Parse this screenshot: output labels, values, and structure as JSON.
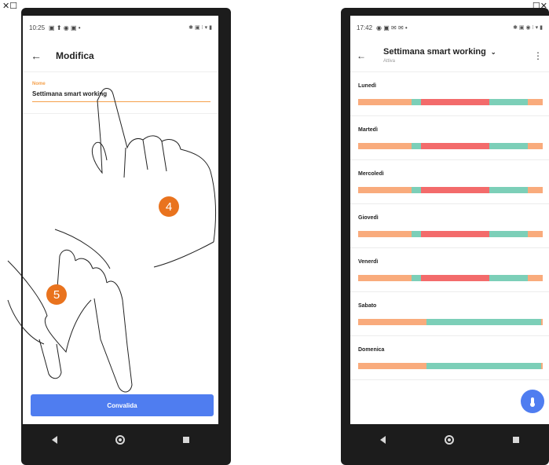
{
  "left_screen": {
    "status_time": "10:25",
    "title": "Modifica",
    "field_label": "Nome",
    "field_value": "Settimana smart working",
    "confirm_label": "Convalida"
  },
  "right_screen": {
    "status_time": "17:42",
    "title": "Settimana smart working",
    "subtitle": "Attiva",
    "days": [
      {
        "label": "Lunedì",
        "segments": [
          {
            "color": "#f9ab7c",
            "frac": 0.29
          },
          {
            "color": "#7ccfb8",
            "frac": 0.05
          },
          {
            "color": "#f36b6b",
            "frac": 0.37
          },
          {
            "color": "#7ccfb8",
            "frac": 0.21
          },
          {
            "color": "#f9ab7c",
            "frac": 0.08
          }
        ]
      },
      {
        "label": "Martedì",
        "segments": [
          {
            "color": "#f9ab7c",
            "frac": 0.29
          },
          {
            "color": "#7ccfb8",
            "frac": 0.05
          },
          {
            "color": "#f36b6b",
            "frac": 0.37
          },
          {
            "color": "#7ccfb8",
            "frac": 0.21
          },
          {
            "color": "#f9ab7c",
            "frac": 0.08
          }
        ]
      },
      {
        "label": "Mercoledì",
        "segments": [
          {
            "color": "#f9ab7c",
            "frac": 0.29
          },
          {
            "color": "#7ccfb8",
            "frac": 0.05
          },
          {
            "color": "#f36b6b",
            "frac": 0.37
          },
          {
            "color": "#7ccfb8",
            "frac": 0.21
          },
          {
            "color": "#f9ab7c",
            "frac": 0.08
          }
        ]
      },
      {
        "label": "Giovedì",
        "segments": [
          {
            "color": "#f9ab7c",
            "frac": 0.29
          },
          {
            "color": "#7ccfb8",
            "frac": 0.05
          },
          {
            "color": "#f36b6b",
            "frac": 0.37
          },
          {
            "color": "#7ccfb8",
            "frac": 0.21
          },
          {
            "color": "#f9ab7c",
            "frac": 0.08
          }
        ]
      },
      {
        "label": "Venerdì",
        "segments": [
          {
            "color": "#f9ab7c",
            "frac": 0.29
          },
          {
            "color": "#7ccfb8",
            "frac": 0.05
          },
          {
            "color": "#f36b6b",
            "frac": 0.37
          },
          {
            "color": "#7ccfb8",
            "frac": 0.21
          },
          {
            "color": "#f9ab7c",
            "frac": 0.08
          }
        ]
      },
      {
        "label": "Sabato",
        "segments": [
          {
            "color": "#f9ab7c",
            "frac": 0.37
          },
          {
            "color": "#7ccfb8",
            "frac": 0.62
          },
          {
            "color": "#f9ab7c",
            "frac": 0.01
          }
        ]
      },
      {
        "label": "Domenica",
        "segments": [
          {
            "color": "#f9ab7c",
            "frac": 0.37
          },
          {
            "color": "#7ccfb8",
            "frac": 0.62
          },
          {
            "color": "#f9ab7c",
            "frac": 0.01
          }
        ]
      }
    ]
  },
  "steps": {
    "first": "4",
    "second": "5"
  },
  "colors": {
    "accent": "#4f7df0",
    "orange": "#e9731e",
    "field_accent": "#f5a04a"
  }
}
